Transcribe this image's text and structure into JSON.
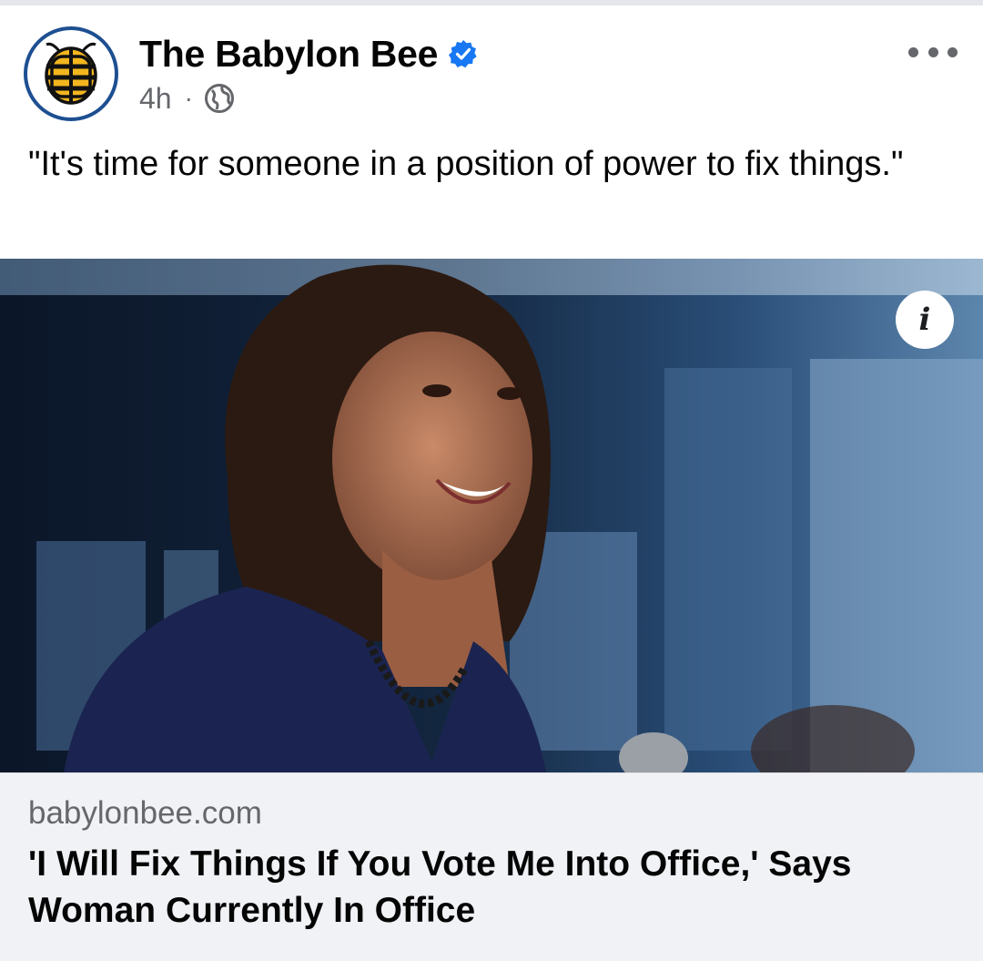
{
  "post": {
    "page_name": "The Babylon Bee",
    "time": "4h",
    "separator": "·",
    "caption": "\"It's time for someone in a position of power to fix things.\"",
    "icons": {
      "avatar": "babylon-bee-logo",
      "verified": "verified-badge-icon",
      "audience": "globe-icon",
      "more": "more-options-icon",
      "info": "info-icon"
    }
  },
  "link_preview": {
    "domain": "babylonbee.com",
    "title": "'I Will Fix Things If You Vote Me Into Office,' Says Woman Currently In Office"
  },
  "colors": {
    "brand_blue": "#1d4f91",
    "verified_blue": "#1877f2",
    "secondary_text": "#65676b",
    "preview_bg": "#f0f2f5"
  }
}
